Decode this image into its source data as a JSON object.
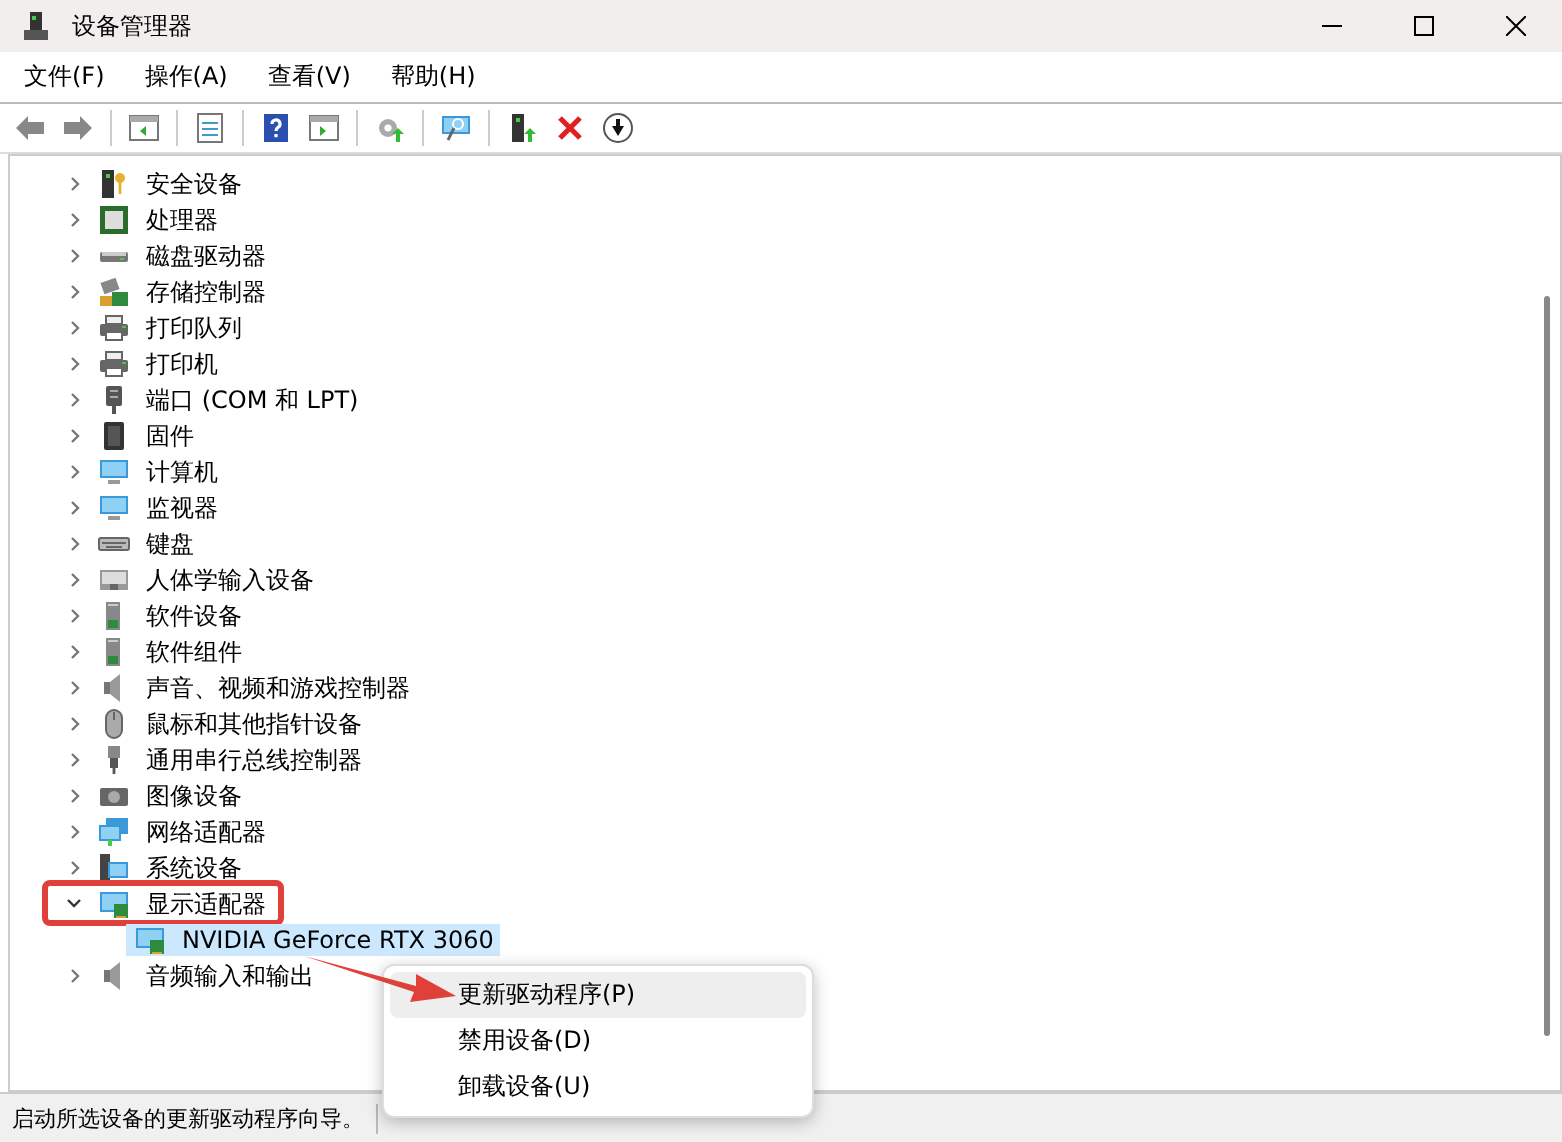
{
  "window": {
    "title": "设备管理器"
  },
  "menu_bar": [
    "文件(F)",
    "操作(A)",
    "查看(V)",
    "帮助(H)"
  ],
  "tree": [
    {
      "label": "安全设备",
      "kind": "security",
      "expanded": false,
      "highlighted": false
    },
    {
      "label": "处理器",
      "kind": "chip",
      "expanded": false,
      "highlighted": false
    },
    {
      "label": "磁盘驱动器",
      "kind": "drive",
      "expanded": false,
      "highlighted": false
    },
    {
      "label": "存储控制器",
      "kind": "storage",
      "expanded": false,
      "highlighted": false
    },
    {
      "label": "打印队列",
      "kind": "printer",
      "expanded": false,
      "highlighted": false
    },
    {
      "label": "打印机",
      "kind": "printer",
      "expanded": false,
      "highlighted": false
    },
    {
      "label": "端口 (COM 和 LPT)",
      "kind": "port",
      "expanded": false,
      "highlighted": false
    },
    {
      "label": "固件",
      "kind": "chip-dark",
      "expanded": false,
      "highlighted": false
    },
    {
      "label": "计算机",
      "kind": "monitor",
      "expanded": false,
      "highlighted": false
    },
    {
      "label": "监视器",
      "kind": "monitor",
      "expanded": false,
      "highlighted": false
    },
    {
      "label": "键盘",
      "kind": "keyboard",
      "expanded": false,
      "highlighted": false
    },
    {
      "label": "人体学输入设备",
      "kind": "hid",
      "expanded": false,
      "highlighted": false
    },
    {
      "label": "软件设备",
      "kind": "tower",
      "expanded": false,
      "highlighted": false
    },
    {
      "label": "软件组件",
      "kind": "tower",
      "expanded": false,
      "highlighted": false
    },
    {
      "label": "声音、视频和游戏控制器",
      "kind": "speaker",
      "expanded": false,
      "highlighted": false
    },
    {
      "label": "鼠标和其他指针设备",
      "kind": "mouse",
      "expanded": false,
      "highlighted": false
    },
    {
      "label": "通用串行总线控制器",
      "kind": "usb",
      "expanded": false,
      "highlighted": false
    },
    {
      "label": "图像设备",
      "kind": "camera",
      "expanded": false,
      "highlighted": false
    },
    {
      "label": "网络适配器",
      "kind": "network",
      "expanded": false,
      "highlighted": false
    },
    {
      "label": "系统设备",
      "kind": "system",
      "expanded": false,
      "highlighted": false
    },
    {
      "label": "显示适配器",
      "kind": "display",
      "expanded": true,
      "highlighted": true,
      "children": [
        {
          "label": "NVIDIA GeForce RTX 3060",
          "kind": "display",
          "selected": true
        }
      ]
    },
    {
      "label": "音频输入和输出",
      "kind": "speaker",
      "expanded": false,
      "highlighted": false
    }
  ],
  "context_menu": [
    {
      "label": "更新驱动程序(P)",
      "selected": true
    },
    {
      "label": "禁用设备(D)",
      "selected": false
    },
    {
      "label": "卸载设备(U)",
      "selected": false
    }
  ],
  "status_bar": "启动所选设备的更新驱动程序向导。"
}
